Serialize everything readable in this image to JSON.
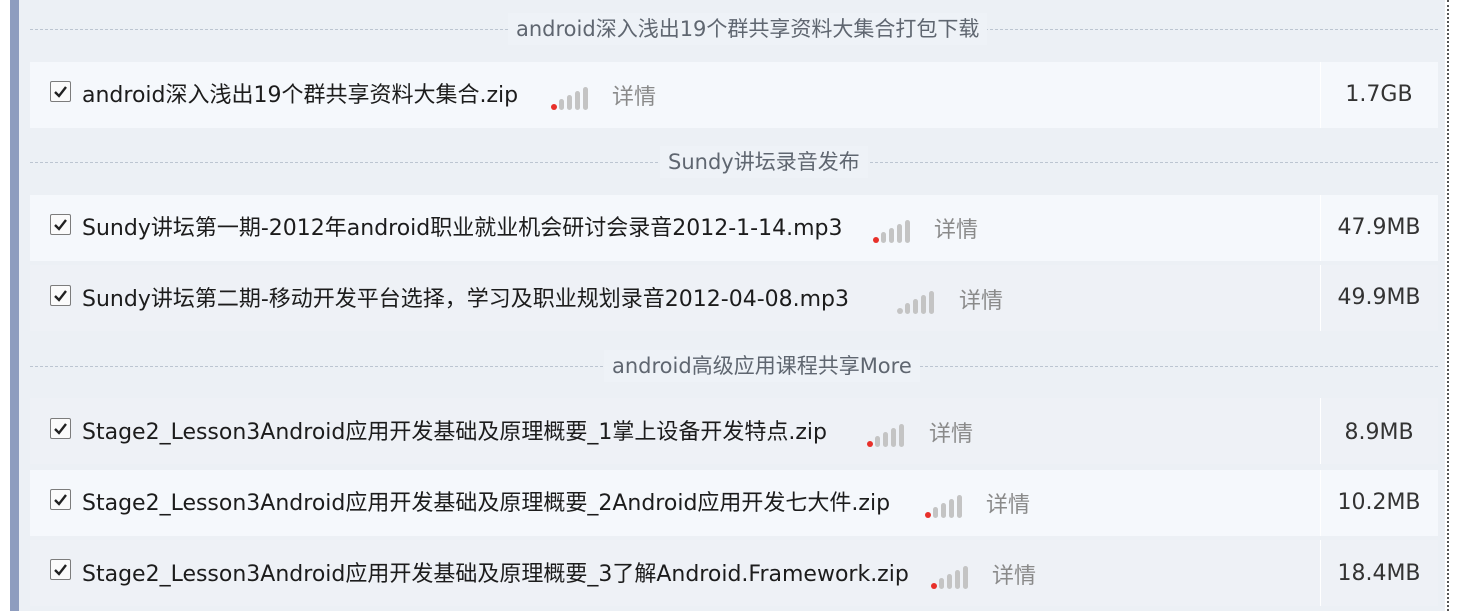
{
  "sections": [
    {
      "title": "android深入浅出19个群共享资料大集合打包下载",
      "files": [
        {
          "name": "android深入浅出19个群共享资料大集合.zip",
          "detail": "详情",
          "size": "1.7GB",
          "checked": true
        }
      ]
    },
    {
      "title": "Sundy讲坛录音发布",
      "files": [
        {
          "name": "Sundy讲坛第一期-2012年android职业就业机会研讨会录音2012-1-14.mp3",
          "detail": "详情",
          "size": "47.9MB",
          "checked": true
        },
        {
          "name": "Sundy讲坛第二期-移动开发平台选择，学习及职业规划录音2012-04-08.mp3",
          "detail": "详情",
          "size": "49.9MB",
          "checked": true
        }
      ]
    },
    {
      "title": "android高级应用课程共享More",
      "files": [
        {
          "name": "Stage2_Lesson3Android应用开发基础及原理概要_1掌上设备开发特点.zip",
          "detail": "详情",
          "size": "8.9MB",
          "checked": true
        },
        {
          "name": "Stage2_Lesson3Android应用开发基础及原理概要_2Android应用开发七大件.zip",
          "detail": "详情",
          "size": "10.2MB",
          "checked": true
        },
        {
          "name": "Stage2_Lesson3Android应用开发基础及原理概要_3了解Android.Framework.zip",
          "detail": "详情",
          "size": "18.4MB",
          "checked": true
        }
      ]
    }
  ],
  "colors": {
    "signal_active": "#e8302a",
    "signal_inactive": "#c4c4c4"
  },
  "icons": {
    "checkbox": "checked-checkbox-icon",
    "signal": "signal-strength-icon"
  }
}
